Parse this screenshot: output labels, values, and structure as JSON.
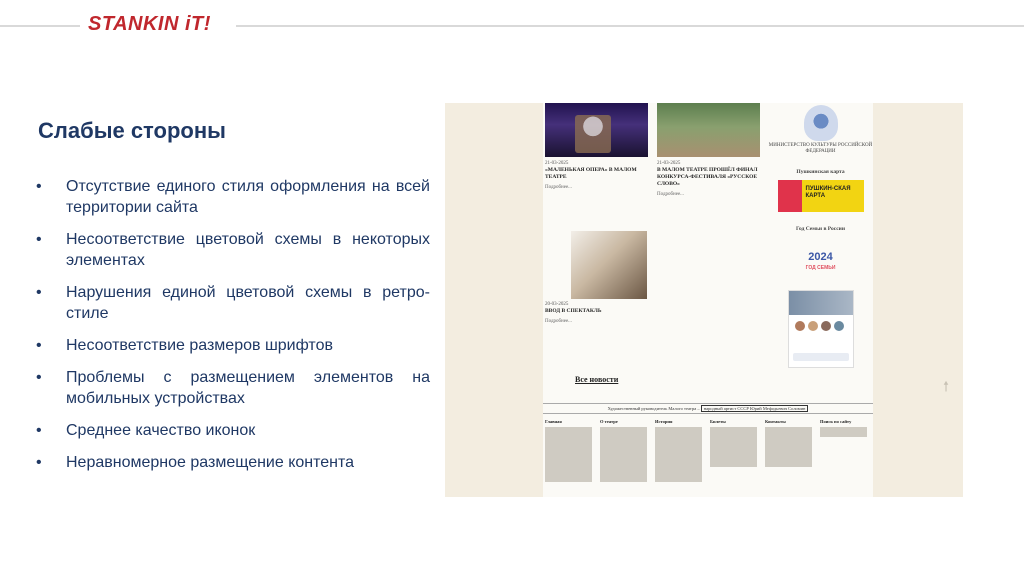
{
  "header": {
    "logo": "STANKIN iT!"
  },
  "slide": {
    "title": "Слабые стороны",
    "bullets": [
      "Отсутствие единого стиля оформления на всей территории сайта",
      "Несоответствие цветовой схемы в некоторых элементах",
      "Нарушения единой цветовой схемы в ретро-стиле",
      "Несоответствие размеров шрифтов",
      "Проблемы с размещением элементов на мобильных устройствах",
      "Среднее качество иконок",
      "Неравномерное размещение контента"
    ]
  },
  "screenshot": {
    "news": [
      {
        "date": "21-03-2025",
        "title": "«МАЛЕНЬКАЯ ОПЕРА» В МАЛОМ ТЕАТРЕ",
        "more": "Подробнее..."
      },
      {
        "date": "21-03-2025",
        "title": "В МАЛОМ ТЕАТРЕ ПРОШЁЛ ФИНАЛ КОНКУРСА-ФЕСТИВАЛЯ «РУССКОЕ СЛОВО»",
        "more": "Подробнее..."
      },
      {
        "date": "20-03-2025",
        "title": "ВВОД В СПЕКТАКЛЬ",
        "more": "Подробнее..."
      }
    ],
    "all_news": "Все новости",
    "ministry": "МИНИСТЕРСТВО КУЛЬТУРЫ РОССИЙСКОЙ ФЕДЕРАЦИИ",
    "pushkin_heading": "Пушкинская карта",
    "pushkin_banner": "ПУШКИН-СКАЯ КАРТА",
    "family_heading": "Год Семьи в России",
    "family_logo": "2024",
    "family_sub": "ГОД СЕМЬИ",
    "footer_line": "Художественный руководитель Малого театра –",
    "footer_box": "народный артист СССР Юрий Мефодьевич Соломин",
    "footer_cols": [
      "Главная",
      "О театре",
      "История",
      "Билеты",
      "Контакты",
      "Поиск по сайту"
    ],
    "scroll_up_icon": "arrow-up-icon"
  }
}
